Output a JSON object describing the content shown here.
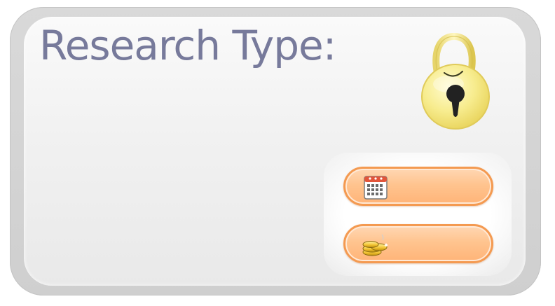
{
  "header": {
    "title": "Research Type:"
  },
  "icons": {
    "lock": "lock-icon",
    "calendar": "calendar-icon",
    "coins": "coins-icon"
  },
  "buttons": {
    "calendar_label": "",
    "coins_label": ""
  },
  "colors": {
    "title": "#777a9b",
    "button_fill": "#ffc48f",
    "button_border": "#f49a51",
    "lock_gold": "#f5e98a"
  }
}
